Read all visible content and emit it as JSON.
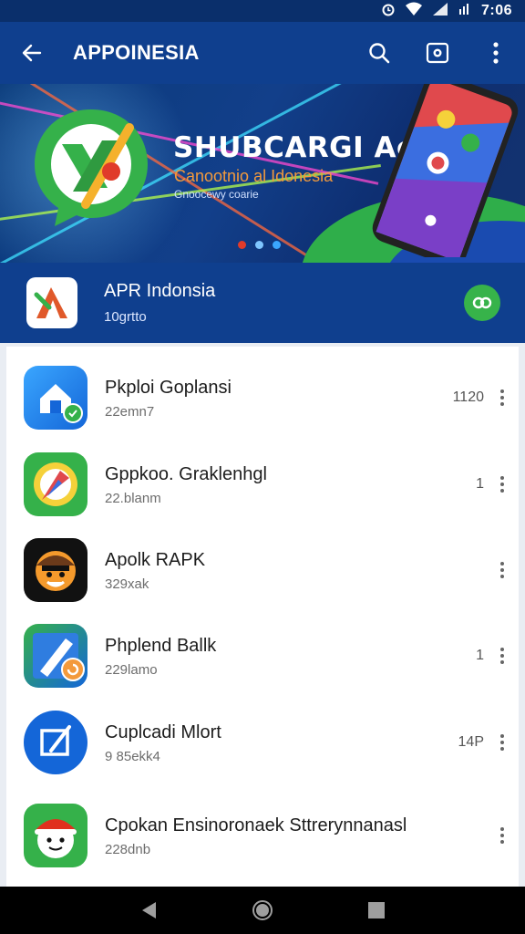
{
  "status_bar": {
    "time": "7:06"
  },
  "app_bar": {
    "title": "APPOINESIA"
  },
  "banner": {
    "headline": "SHUBCARGI AcI",
    "subtitle": "Canootnio al Idonesia",
    "tagline": "Gnoocewy coarie",
    "dots": [
      "#e03b2a",
      "#7fc6ff",
      "#3aa6ff"
    ]
  },
  "featured": {
    "name": "APR Indonsia",
    "meta": "10grtto"
  },
  "apps": [
    {
      "name": "Pkploi Goplansi",
      "meta": "22emn7",
      "size": "1120",
      "icon": "house-icon"
    },
    {
      "name": "Gppkoo. Graklenhgl",
      "meta": "22.blanm",
      "size": "1",
      "icon": "pen-nib-icon"
    },
    {
      "name": "Apolk RAPK",
      "meta": "329xak",
      "size": "",
      "icon": "mascot-face-icon"
    },
    {
      "name": "Phplend Ballk",
      "meta": "229lamo",
      "size": "1",
      "icon": "pencil-refresh-icon"
    },
    {
      "name": "Cuplcadi Mlort",
      "meta": "9 85ekk4",
      "size": "14P",
      "icon": "edit-square-icon"
    },
    {
      "name": "Cpokan Ensinoronaek Sttrerynnanasl",
      "meta": "228dnb",
      "size": "",
      "icon": "santa-face-icon"
    }
  ],
  "colors": {
    "primary": "#0f3f8e",
    "status": "#0a2f6b",
    "accent_green": "#37b34a",
    "accent_orange": "#f39a3c"
  }
}
